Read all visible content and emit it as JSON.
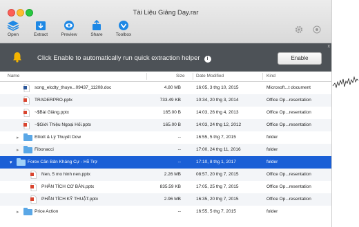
{
  "window": {
    "title": "Tài Liệu Giảng Dạy.rar"
  },
  "toolbar": [
    {
      "label": "Open",
      "icon": "layers-icon",
      "color": "#1e88e5"
    },
    {
      "label": "Extract",
      "icon": "extract-icon",
      "color": "#1e88e5"
    },
    {
      "label": "Preview",
      "icon": "eye-icon",
      "color": "#1e88e5"
    },
    {
      "label": "Share",
      "icon": "share-icon",
      "color": "#1e88e5"
    },
    {
      "label": "Toolbox",
      "icon": "toolbox-icon",
      "color": "#1e88e5"
    }
  ],
  "banner": {
    "text": "Click Enable to automatically run quick extraction helper",
    "info": "i",
    "button": "Enable",
    "close": "x"
  },
  "columns": {
    "name": "Name",
    "size": "Size",
    "date": "Date Modified",
    "kind": "Kind"
  },
  "files": [
    {
      "name": "song_elcdty_thuye...09437_11208.doc",
      "size": "4.80 MB",
      "date": "16:05, 3 thg 10, 2015",
      "kind": "Microsoft...t document",
      "type": "doc",
      "indent": 1
    },
    {
      "name": "TRADERPRO.pptx",
      "size": "733.49 KB",
      "date": "10:34, 20 thg 3, 2014",
      "kind": "Office Op...resentation",
      "type": "ppt",
      "indent": 1
    },
    {
      "name": "~$Bài Giảng.pptx",
      "size": "165.00 B",
      "date": "14:03, 26 thg 4, 2013",
      "kind": "Office Op...resentation",
      "type": "ppt",
      "indent": 1
    },
    {
      "name": "~$Giới Thiệu Ngoại Hối.pptx",
      "size": "165.00 B",
      "date": "14:03, 24 thg 12, 2012",
      "kind": "Office Op...resentation",
      "type": "ppt",
      "indent": 1
    },
    {
      "name": "Elliott & Lý Thuyết Dow",
      "size": "--",
      "date": "16:55, 5 thg 7, 2015",
      "kind": "folder",
      "type": "folder",
      "indent": 1,
      "disclose": "▸"
    },
    {
      "name": "Fibonacci",
      "size": "--",
      "date": "17:00, 24 thg 11, 2016",
      "kind": "folder",
      "type": "folder",
      "indent": 1,
      "disclose": "▸"
    },
    {
      "name": "Forex Căn Bản Kháng Cự - Hỗ Trợ",
      "size": "--",
      "date": "17:10, 8 thg 1, 2017",
      "kind": "folder",
      "type": "folder",
      "indent": 0,
      "disclose": "▾",
      "selected": true
    },
    {
      "name": "Nen, 5 mo hinh nen.pptx",
      "size": "2.26 MB",
      "date": "08:57, 20 thg 7, 2015",
      "kind": "Office Op...resentation",
      "type": "ppt",
      "indent": 2
    },
    {
      "name": "PHÂN TÍCH CƠ BẢN.pptx",
      "size": "835.59 KB",
      "date": "17:05, 25 thg 7, 2015",
      "kind": "Office Op...resentation",
      "type": "ppt",
      "indent": 2
    },
    {
      "name": "PHÂN TÍCH KỸ THUẬT.pptx",
      "size": "2.96 MB",
      "date": "16:35, 20 thg 7, 2015",
      "kind": "Office Op...resentation",
      "type": "ppt",
      "indent": 2
    },
    {
      "name": "Price Action",
      "size": "--",
      "date": "16:55, 5 thg 7, 2015",
      "kind": "folder",
      "type": "folder",
      "indent": 1,
      "disclose": "▸"
    }
  ],
  "status": "",
  "colors": {
    "selection": "#1a5fd6",
    "banner": "#4d5257",
    "folder": "#5aa7e6",
    "ppt": "#d9442e"
  }
}
